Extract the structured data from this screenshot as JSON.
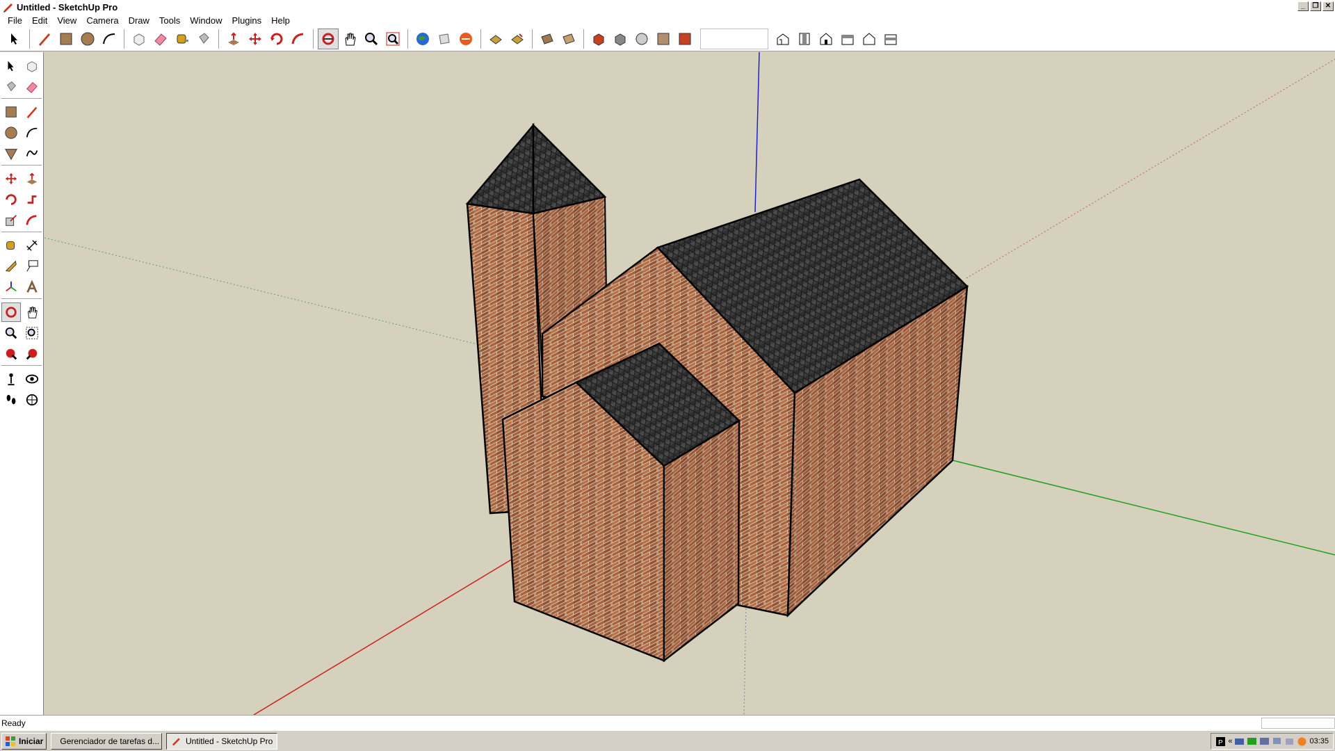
{
  "window": {
    "title": "Untitled - SketchUp Pro",
    "buttons": [
      "_",
      "❐",
      "✕"
    ]
  },
  "menu": [
    "File",
    "Edit",
    "View",
    "Camera",
    "Draw",
    "Tools",
    "Window",
    "Plugins",
    "Help"
  ],
  "toolbar": {
    "tools": [
      "select-icon",
      "pencil-icon",
      "rectangle-icon",
      "circle-icon",
      "arc-icon",
      "make-component-icon",
      "eraser-icon",
      "tape-measure-icon",
      "paint-bucket-icon",
      "push-pull-icon",
      "move-icon",
      "rotate-icon",
      "follow-me-icon",
      "orbit-icon",
      "pan-icon",
      "zoom-icon",
      "zoom-extents-icon",
      "google-earth-icon",
      "get-models-icon",
      "share-model-icon",
      "previous-view-icon",
      "next-view-icon",
      "section-plane-icon",
      "section-cuts-icon",
      "xray-icon",
      "wireframe-icon",
      "hidden-line-icon",
      "shaded-icon",
      "shaded-textures-icon",
      "monochrome-icon",
      "iso-view-icon",
      "top-view-icon",
      "front-view-icon",
      "right-view-icon",
      "back-view-icon",
      "left-view-icon"
    ],
    "active_tool": "orbit-icon"
  },
  "left_tools": [
    "select",
    "make-component",
    "paint-bucket",
    "eraser",
    "rectangle",
    "line",
    "circle",
    "arc",
    "polygon",
    "freehand",
    "move",
    "push-pull",
    "rotate",
    "follow-me",
    "scale",
    "offset",
    "tape-measure",
    "dimension",
    "protractor",
    "text",
    "axes",
    "3d-text",
    "orbit",
    "pan",
    "zoom",
    "zoom-window",
    "zoom-extents",
    "previous",
    "position-camera",
    "look-around",
    "walk",
    "section-plane"
  ],
  "status": {
    "text": "Ready",
    "measurements": ""
  },
  "taskbar": {
    "start_label": "Iniciar",
    "tasks": [
      {
        "label": "Gerenciador de tarefas d...",
        "active": false
      },
      {
        "label": "Untitled - SketchUp Pro",
        "active": true
      }
    ],
    "clock": "03:35",
    "tray_chevron": "«"
  },
  "colors": {
    "viewport_bg": "#d5d1bd",
    "axis_red": "#cc2020",
    "axis_green": "#20a020",
    "axis_blue": "#2020c8",
    "brick": "#9a5a3c",
    "roof": "#3a3a3a"
  }
}
